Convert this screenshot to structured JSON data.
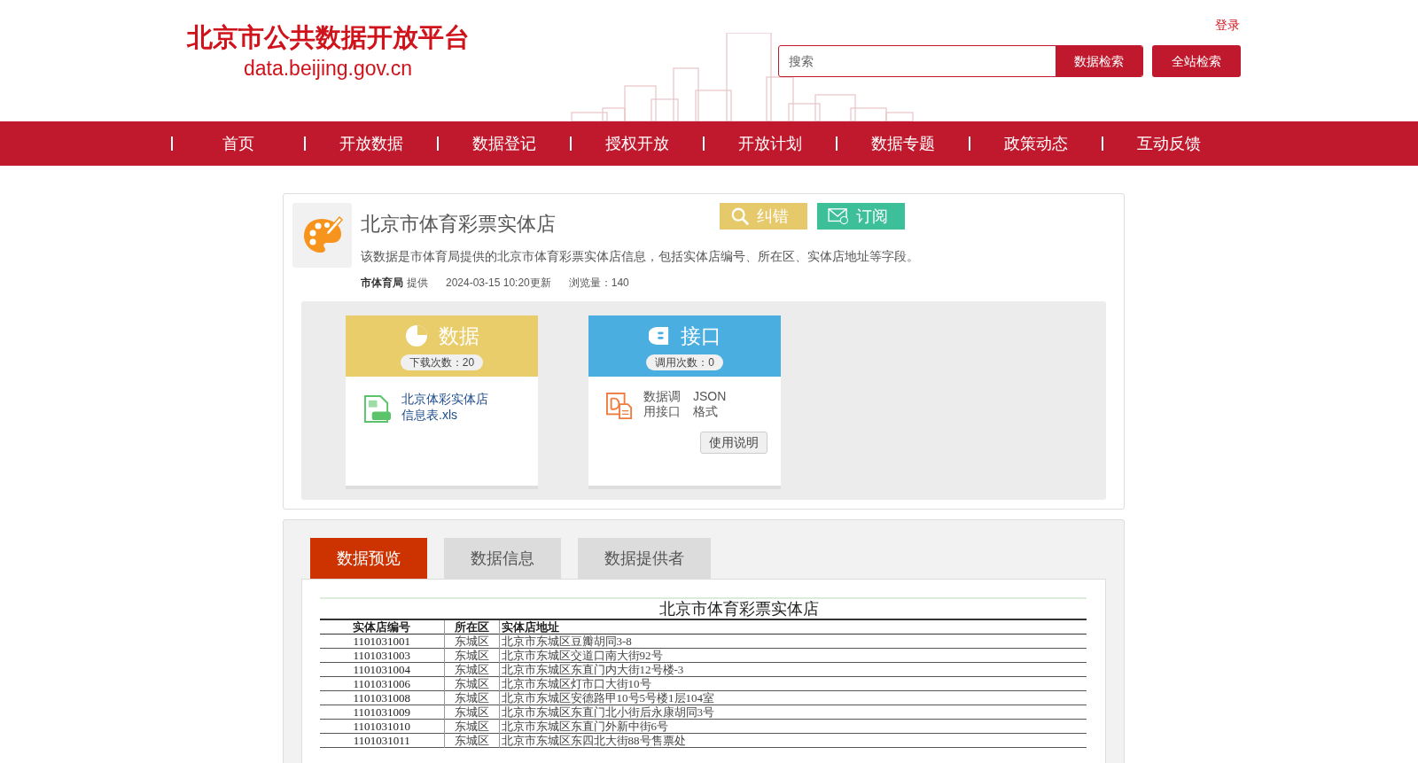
{
  "header": {
    "logo_title": "北京市公共数据开放平台",
    "logo_url": "data.beijing.gov.cn",
    "login": "登录",
    "search": {
      "placeholder": "搜索"
    },
    "search_buttons": [
      "数据检索",
      "全站检索"
    ]
  },
  "nav": [
    {
      "label": "首页"
    },
    {
      "label": "开放数据"
    },
    {
      "label": "数据登记"
    },
    {
      "label": "授权开放"
    },
    {
      "label": "开放计划"
    },
    {
      "label": "数据专题"
    },
    {
      "label": "政策动态"
    },
    {
      "label": "互动反馈"
    }
  ],
  "dataset": {
    "title": "北京市体育彩票实体店",
    "actions": [
      {
        "kind": "report",
        "label": "纠错"
      },
      {
        "kind": "subscribe",
        "label": "订阅"
      }
    ],
    "description": "该数据是市体育局提供的北京市体育彩票实体店信息，包括实体店编号、所在区、实体店地址等字段。",
    "provider": "市体育局",
    "provider_suffix": "提供",
    "updated": "2024-03-15 10:20更新",
    "views": "浏览量：140"
  },
  "resources": [
    {
      "kind": "data",
      "title": "数据",
      "counter": "下载次数：20",
      "file": "北京体彩实体店信息表.xls"
    },
    {
      "kind": "api",
      "title": "接口",
      "counter": "调用次数：0",
      "name": "数据调用接口",
      "format": "JSON格式",
      "button": "使用说明"
    }
  ],
  "tabs": [
    {
      "label": "数据预览",
      "selected": true
    },
    {
      "label": "数据信息",
      "selected": false
    },
    {
      "label": "数据提供者",
      "selected": false
    }
  ],
  "preview": {
    "title": "北京市体育彩票实体店",
    "columns": [
      "实体店编号",
      "所在区",
      "实体店地址"
    ],
    "rows": [
      [
        "1101031001",
        "东城区",
        "北京市东城区豆瓣胡同3-8"
      ],
      [
        "1101031003",
        "东城区",
        "北京市东城区交道口南大街92号"
      ],
      [
        "1101031004",
        "东城区",
        "北京市东城区东直门内大街12号楼-3"
      ],
      [
        "1101031006",
        "东城区",
        "北京市东城区灯市口大街10号"
      ],
      [
        "1101031008",
        "东城区",
        "北京市东城区安德路甲10号5号楼1层104室"
      ],
      [
        "1101031009",
        "东城区",
        "北京市东城区东直门北小街后永康胡同3号"
      ],
      [
        "1101031010",
        "东城区",
        "北京市东城区东直门外新中街6号"
      ],
      [
        "1101031011",
        "东城区",
        "北京市东城区东四北大街88号售票处"
      ]
    ]
  }
}
